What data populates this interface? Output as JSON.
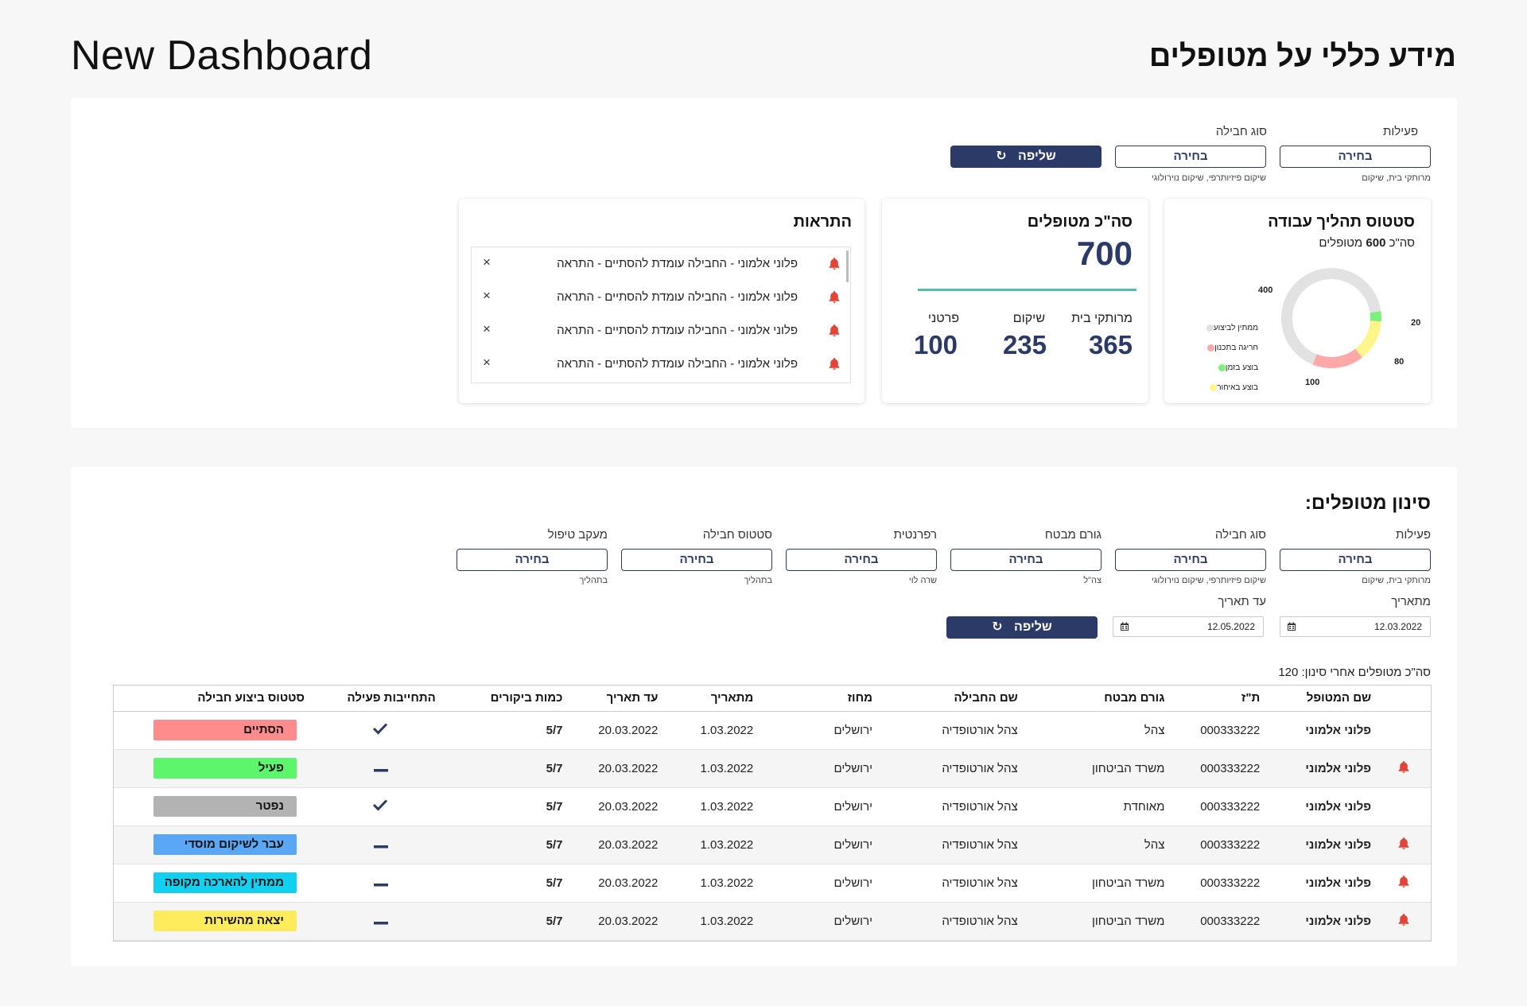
{
  "header": {
    "app_title": "New Dashboard",
    "section_title": "מידע כללי על מטופלים"
  },
  "top_filters": [
    {
      "label": "פעילות",
      "button": "בחירה",
      "sub": "מרותקי בית, שיקום"
    },
    {
      "label": "סוג חבילה",
      "button": "בחירה",
      "sub": "שיקום פיזיותרפי, שיקום נוירולוגי"
    }
  ],
  "fetch_button": "שליפה",
  "status_card": {
    "title": "סטטוס תהליך עבודה",
    "subtitle_prefix": "סה\"כ",
    "subtitle_total": "600",
    "subtitle_suffix": "מטופלים",
    "legend": [
      {
        "label": "ממתין לביצוע",
        "color": "#e0e0e0"
      },
      {
        "label": "חריגה בתכנון",
        "color": "#ffa8a8"
      },
      {
        "label": "בוצע בזמן",
        "color": "#7cf07c"
      },
      {
        "label": "בוצע באיחור",
        "color": "#fff58a"
      }
    ],
    "segments": [
      {
        "name": "ממתין לביצוע",
        "value": 400,
        "color": "#e2e2e2"
      },
      {
        "name": "חריגה בתכנון",
        "value": 100,
        "color": "#ffa8a8"
      },
      {
        "name": "בוצע באיחור",
        "value": 80,
        "color": "#fff58a"
      },
      {
        "name": "בוצע בזמן",
        "value": 20,
        "color": "#7cf07c"
      }
    ],
    "labels": {
      "v400": "400",
      "v20": "20",
      "v80": "80",
      "v100": "100"
    }
  },
  "total_card": {
    "title": "סה\"כ מטופלים",
    "total": "700",
    "accent": "#4fc0b0",
    "breakdown": [
      {
        "label": "מרותקי בית",
        "value": "365"
      },
      {
        "label": "שיקום",
        "value": "235"
      },
      {
        "label": "פרטני",
        "value": "100"
      }
    ]
  },
  "alerts_card": {
    "title": "התראות",
    "items": [
      {
        "text": "פלוני אלמוני - החבילה עומדת להסתיים - התראה"
      },
      {
        "text": "פלוני אלמוני - החבילה עומדת להסתיים - התראה"
      },
      {
        "text": "פלוני אלמוני - החבילה עומדת להסתיים - התראה"
      },
      {
        "text": "פלוני אלמוני - החבילה עומדת להסתיים - התראה"
      }
    ]
  },
  "filter_section": {
    "title": "סינון מטופלים:",
    "filters": [
      {
        "label": "פעילות",
        "button": "בחירה",
        "sub": "מרותקי בית, שיקום"
      },
      {
        "label": "סוג חבילה",
        "button": "בחירה",
        "sub": "שיקום פיזיותרפי, שיקום נוירולוגי"
      },
      {
        "label": "גורם מבטח",
        "button": "בחירה",
        "sub": "צה\"ל"
      },
      {
        "label": "רפרנטית",
        "button": "בחירה",
        "sub": "שרה לוי"
      },
      {
        "label": "סטטוס חבילה",
        "button": "בחירה",
        "sub": "בתהליך"
      },
      {
        "label": "מעקב טיפול",
        "button": "בחירה",
        "sub": "בתהליך"
      }
    ],
    "from_date_label": "מתאריך",
    "from_date": "12.03.2022",
    "to_date_label": "עד תאריך",
    "to_date": "12.05.2022",
    "fetch_button": "שליפה",
    "result_count": "סה\"כ מטופלים אחרי סינון: 120"
  },
  "table": {
    "headers": [
      "שם המטופל",
      "ת\"ז",
      "גורם מבטח",
      "שם החבילה",
      "מחוז",
      "מתאריך",
      "עד תאריך",
      "כמות ביקורים",
      "התחייבות פעילה",
      "סטטוס ביצוע חבילה"
    ],
    "rows": [
      {
        "bell": false,
        "name": "פלוני אלמוני",
        "id": "000333222",
        "insurer": "צהל",
        "package": "צהל אורטופדיה",
        "district": "ירושלים",
        "from": "1.03.2022",
        "to": "20.03.2022",
        "visits": "5/7",
        "commitment": "check",
        "status": "הסתיים",
        "status_color": "#ff8c8c"
      },
      {
        "bell": true,
        "name": "פלוני אלמוני",
        "id": "000333222",
        "insurer": "משרד הביטחון",
        "package": "צהל אורטופדיה",
        "district": "ירושלים",
        "from": "1.03.2022",
        "to": "20.03.2022",
        "visits": "5/7",
        "commitment": "dash",
        "status": "פעיל",
        "status_color": "#5cf56c"
      },
      {
        "bell": false,
        "name": "פלוני אלמוני",
        "id": "000333222",
        "insurer": "מאוחדת",
        "package": "צהל אורטופדיה",
        "district": "ירושלים",
        "from": "1.03.2022",
        "to": "20.03.2022",
        "visits": "5/7",
        "commitment": "check",
        "status": "נפטר",
        "status_color": "#b3b3b3"
      },
      {
        "bell": true,
        "name": "פלוני אלמוני",
        "id": "000333222",
        "insurer": "צהל",
        "package": "צהל אורטופדיה",
        "district": "ירושלים",
        "from": "1.03.2022",
        "to": "20.03.2022",
        "visits": "5/7",
        "commitment": "dash",
        "status": "עבר לשיקום מוסדי",
        "status_color": "#5aa8f5"
      },
      {
        "bell": true,
        "name": "פלוני אלמוני",
        "id": "000333222",
        "insurer": "משרד הביטחון",
        "package": "צהל אורטופדיה",
        "district": "ירושלים",
        "from": "1.03.2022",
        "to": "20.03.2022",
        "visits": "5/7",
        "commitment": "dash",
        "status": "ממתין להארכה מקופה",
        "status_color": "#12d0f0"
      },
      {
        "bell": true,
        "name": "פלוני אלמוני",
        "id": "000333222",
        "insurer": "משרד הביטחון",
        "package": "צהל אורטופדיה",
        "district": "ירושלים",
        "from": "1.03.2022",
        "to": "20.03.2022",
        "visits": "5/7",
        "commitment": "dash",
        "status": "יצאה מהשירות",
        "status_color": "#ffec5c"
      }
    ]
  }
}
